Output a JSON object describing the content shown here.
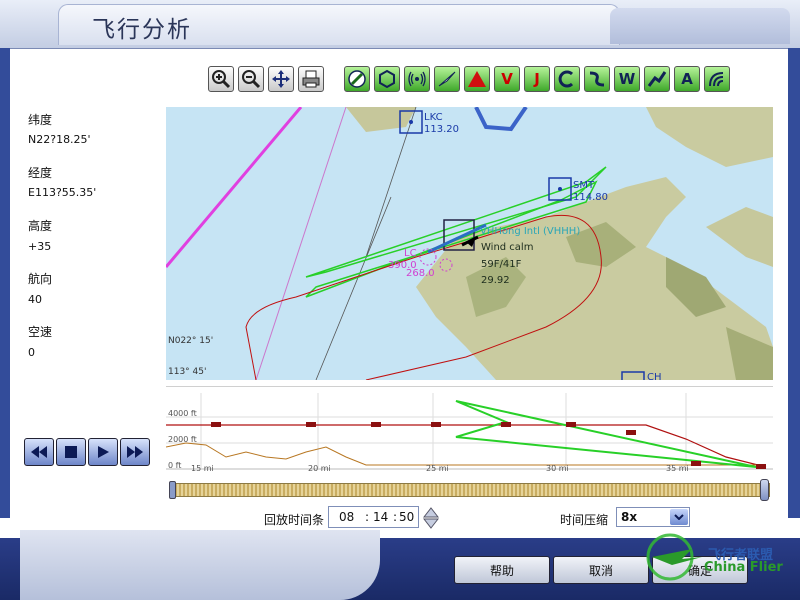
{
  "window": {
    "title": "飞行分析"
  },
  "toolbar": {
    "buttons": [
      "zoom-in-icon",
      "zoom-out-icon",
      "pan-icon",
      "print-icon",
      "vor-icon",
      "ndb-icon",
      "ils-icon",
      "airport-icon",
      "warning-icon",
      "victor-airway-icon",
      "jet-airway-icon",
      "approach-icon",
      "route-icon",
      "waypoint-icon",
      "airway-icon",
      "altitude-icon",
      "wind-icon"
    ],
    "labels": {
      "v": "V",
      "j": "J",
      "w": "W",
      "a": "A"
    }
  },
  "fields": {
    "latitude": {
      "label": "纬度",
      "value": "N22?18.25'"
    },
    "longitude": {
      "label": "经度",
      "value": "E113?55.35'"
    },
    "altitude": {
      "label": "高度",
      "value": "+35"
    },
    "heading": {
      "label": "航向",
      "value": "40"
    },
    "airspeed": {
      "label": "空速",
      "value": "0"
    }
  },
  "map": {
    "labels": {
      "lkc_name": "LKC",
      "lkc_freq": "113.20",
      "smt_name": "SMT",
      "smt_freq": "114.80",
      "airport": "VHHong Intl (VHHH)",
      "wind": "Wind calm",
      "temp": "59F/41F",
      "pressure": "29.92",
      "lc_name": "LC",
      "lc_freq1": "390.0",
      "lc_freq2": "268.0",
      "lat_tick": "N022° 15'",
      "lon_tick": "113° 45'",
      "ch_name": "CH"
    }
  },
  "profile": {
    "y_labels": [
      "4000 ft",
      "2000 ft",
      "0 ft"
    ],
    "x_labels": [
      "15 mi",
      "20 mi",
      "25 mi",
      "30 mi",
      "35 mi"
    ]
  },
  "playback": {
    "buttons": [
      "rewind-icon",
      "stop-icon",
      "play-icon",
      "fast-forward-icon"
    ],
    "replay_label": "回放时间条",
    "time": {
      "h": "08",
      "m": "14",
      "s": "50"
    },
    "progress": 0.99
  },
  "compression": {
    "label": "时间压缩",
    "value": "8x"
  },
  "buttons": {
    "help": "帮助",
    "cancel": "取消",
    "ok": "确定"
  },
  "logo": {
    "cn": "飞行者联盟",
    "en": "China Flier"
  }
}
